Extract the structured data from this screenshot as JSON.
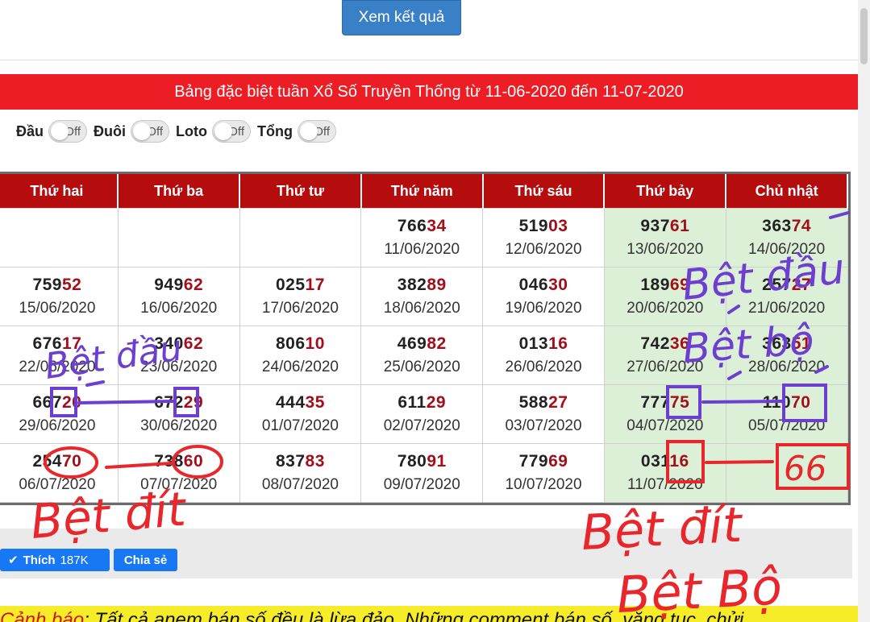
{
  "header": {
    "submit_label": "Xem kết quả"
  },
  "title": "Bảng đặc biệt tuần Xổ Số Truyền Thống từ 11-06-2020 đến 11-07-2020",
  "toggles": [
    {
      "label": "Đầu",
      "state": "Off"
    },
    {
      "label": "Đuôi",
      "state": "Off"
    },
    {
      "label": "Loto",
      "state": "Off"
    },
    {
      "label": "Tổng",
      "state": "Off"
    }
  ],
  "table": {
    "headers": [
      "Thứ hai",
      "Thứ ba",
      "Thứ tư",
      "Thứ năm",
      "Thứ sáu",
      "Thứ bảy",
      "Chủ nhật"
    ],
    "rows": [
      [
        null,
        null,
        null,
        {
          "head": "766",
          "tail": "34",
          "date": "11/06/2020"
        },
        {
          "head": "519",
          "tail": "03",
          "date": "12/06/2020"
        },
        {
          "head": "937",
          "tail": "61",
          "date": "13/06/2020"
        },
        {
          "head": "363",
          "tail": "74",
          "date": "14/06/2020"
        }
      ],
      [
        {
          "head": "759",
          "tail": "52",
          "date": "15/06/2020"
        },
        {
          "head": "949",
          "tail": "62",
          "date": "16/06/2020"
        },
        {
          "head": "025",
          "tail": "17",
          "date": "17/06/2020"
        },
        {
          "head": "382",
          "tail": "89",
          "date": "18/06/2020"
        },
        {
          "head": "046",
          "tail": "30",
          "date": "19/06/2020"
        },
        {
          "head": "189",
          "tail": "69",
          "date": "20/06/2020"
        },
        {
          "head": "257",
          "tail": "27",
          "date": "21/06/2020"
        }
      ],
      [
        {
          "head": "676",
          "tail": "17",
          "date": "22/06/2020"
        },
        {
          "head": "340",
          "tail": "62",
          "date": "23/06/2020"
        },
        {
          "head": "806",
          "tail": "10",
          "date": "24/06/2020"
        },
        {
          "head": "469",
          "tail": "82",
          "date": "25/06/2020"
        },
        {
          "head": "013",
          "tail": "16",
          "date": "26/06/2020"
        },
        {
          "head": "742",
          "tail": "36",
          "date": "27/06/2020"
        },
        {
          "head": "363",
          "tail": "51",
          "date": "28/06/2020"
        }
      ],
      [
        {
          "head": "667",
          "tail": "20",
          "date": "29/06/2020"
        },
        {
          "head": "672",
          "tail": "29",
          "date": "30/06/2020"
        },
        {
          "head": "444",
          "tail": "35",
          "date": "01/07/2020"
        },
        {
          "head": "611",
          "tail": "29",
          "date": "02/07/2020"
        },
        {
          "head": "588",
          "tail": "27",
          "date": "03/07/2020"
        },
        {
          "head": "777",
          "tail": "75",
          "date": "04/07/2020"
        },
        {
          "head": "110",
          "tail": "70",
          "date": "05/07/2020"
        }
      ],
      [
        {
          "head": "254",
          "tail": "70",
          "date": "06/07/2020"
        },
        {
          "head": "738",
          "tail": "60",
          "date": "07/07/2020"
        },
        {
          "head": "837",
          "tail": "83",
          "date": "08/07/2020"
        },
        {
          "head": "780",
          "tail": "91",
          "date": "09/07/2020"
        },
        {
          "head": "779",
          "tail": "69",
          "date": "10/07/2020"
        },
        {
          "head": "031",
          "tail": "16",
          "date": "11/07/2020"
        },
        null
      ]
    ]
  },
  "annotations": {
    "bet_dau_left": "Bệt đầu",
    "bet_dau_right": "Bệt đầu",
    "bet_bo_right": "Bệt bộ",
    "bet_dit_left": "Bệt đít",
    "bet_dit_right": "Bệt đít",
    "bet_bo_bottom": "Bệt Bộ",
    "box_66": "66",
    "colors": {
      "red": "#e8262b",
      "purple": "#6d3fd0"
    }
  },
  "social": {
    "like_label": "Thích",
    "like_count": "187K",
    "share_label": "Chia sẻ"
  },
  "warning": {
    "label": "Cảnh báo",
    "text": ": Tất cả anem bán số đều là lừa đảo. Những comment bán số, văng tục, chửi"
  }
}
